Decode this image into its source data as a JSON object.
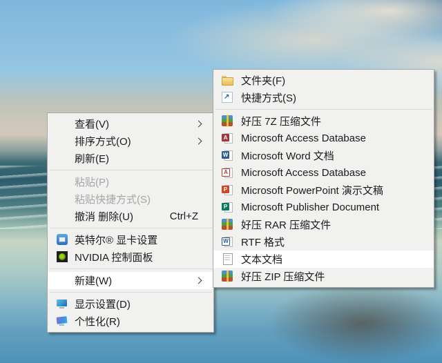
{
  "colors": {
    "menu_bg": "#f1f1f0",
    "menu_border": "#a6a6a6",
    "highlight": "#ffffff",
    "text": "#1b1b1b",
    "disabled_text": "#a5a5a5",
    "separator": "#d8d8d8"
  },
  "desktop_context_menu": {
    "items": [
      {
        "name": "menu-item-view",
        "label": "查看(V)",
        "submenu": true
      },
      {
        "name": "menu-item-sort-by",
        "label": "排序方式(O)",
        "submenu": true
      },
      {
        "name": "menu-item-refresh",
        "label": "刷新(E)"
      },
      {
        "type": "separator"
      },
      {
        "name": "menu-item-paste",
        "label": "粘贴(P)",
        "disabled": true
      },
      {
        "name": "menu-item-paste-shortcut",
        "label": "粘贴快捷方式(S)",
        "disabled": true
      },
      {
        "name": "menu-item-undo-delete",
        "label": "撤消 删除(U)",
        "shortcut": "Ctrl+Z"
      },
      {
        "type": "separator"
      },
      {
        "name": "menu-item-intel-graphics-settings",
        "label": "英特尔® 显卡设置",
        "icon": {
          "name": "intel-graphics-icon",
          "type": "icon-intel"
        }
      },
      {
        "name": "menu-item-nvidia-control-panel",
        "label": "NVIDIA 控制面板",
        "icon": {
          "name": "nvidia-icon",
          "type": "icon-nvidia"
        }
      },
      {
        "type": "separator"
      },
      {
        "name": "menu-item-new",
        "label": "新建(W)",
        "submenu": true,
        "highlighted": true
      },
      {
        "type": "separator"
      },
      {
        "name": "menu-item-display-settings",
        "label": "显示设置(D)",
        "icon": {
          "name": "display-settings-icon",
          "type": "icon-display"
        }
      },
      {
        "name": "menu-item-personalize",
        "label": "个性化(R)",
        "icon": {
          "name": "personalize-icon",
          "type": "icon-personalize"
        }
      }
    ]
  },
  "new_submenu": {
    "items": [
      {
        "name": "submenu-item-folder",
        "label": "文件夹(F)",
        "icon": {
          "name": "folder-icon",
          "type": "icon-folder"
        }
      },
      {
        "name": "submenu-item-shortcut",
        "label": "快捷方式(S)",
        "icon": {
          "name": "shortcut-icon",
          "type": "icon-shortcut"
        }
      },
      {
        "type": "separator"
      },
      {
        "name": "submenu-item-haozip-7z",
        "label": "好压 7Z 压缩文件",
        "icon": {
          "name": "haozip-archive-icon",
          "type": "icon-haozip"
        }
      },
      {
        "name": "submenu-item-access-database",
        "label": "Microsoft Access Database",
        "icon": {
          "name": "access-icon",
          "type": "icon-office",
          "badge": "A",
          "badge_color": "#A33639"
        }
      },
      {
        "name": "submenu-item-word-document",
        "label": "Microsoft Word 文档",
        "icon": {
          "name": "word-icon",
          "type": "icon-office",
          "badge": "W",
          "badge_color": "#2C5898"
        }
      },
      {
        "name": "submenu-item-access-database-2",
        "label": "Microsoft Access Database",
        "icon": {
          "name": "access-legacy-icon",
          "type": "icon-office outline",
          "badge": "A",
          "badge_color": "#B23A3E"
        }
      },
      {
        "name": "submenu-item-powerpoint-presentation",
        "label": "Microsoft PowerPoint 演示文稿",
        "icon": {
          "name": "powerpoint-icon",
          "type": "icon-office",
          "badge": "P",
          "badge_color": "#D04727"
        }
      },
      {
        "name": "submenu-item-publisher-document",
        "label": "Microsoft Publisher Document",
        "icon": {
          "name": "publisher-icon",
          "type": "icon-office",
          "badge": "P",
          "badge_color": "#0A7A63"
        }
      },
      {
        "name": "submenu-item-haozip-rar",
        "label": "好压 RAR 压缩文件",
        "icon": {
          "name": "haozip-archive-icon",
          "type": "icon-haozip"
        }
      },
      {
        "name": "submenu-item-rtf",
        "label": "RTF 格式",
        "icon": {
          "name": "rtf-icon",
          "type": "icon-office outline",
          "badge": "W",
          "badge_color": "#2C5898"
        }
      },
      {
        "name": "submenu-item-text-document",
        "label": "文本文档",
        "highlighted": true,
        "icon": {
          "name": "text-document-icon",
          "type": "icon-textdoc"
        }
      },
      {
        "name": "submenu-item-haozip-zip",
        "label": "好压 ZIP 压缩文件",
        "icon": {
          "name": "haozip-archive-icon",
          "type": "icon-haozip"
        }
      }
    ]
  }
}
